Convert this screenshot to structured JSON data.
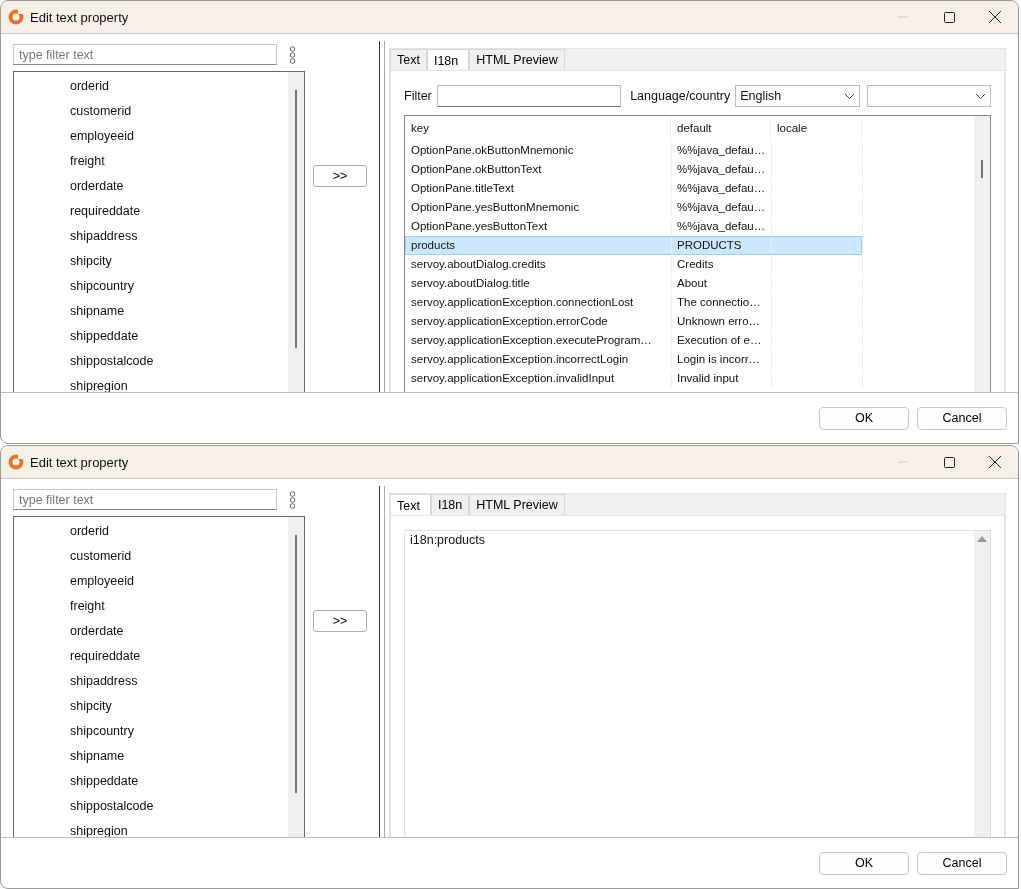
{
  "dialogs": [
    {
      "title": "Edit text property",
      "filter": {
        "placeholder": "type filter text"
      },
      "fields": [
        "orderid",
        "customerid",
        "employeeid",
        "freight",
        "orderdate",
        "requireddate",
        "shipaddress",
        "shipcity",
        "shipcountry",
        "shipname",
        "shippeddate",
        "shippostalcode",
        "shipregion"
      ],
      "move_button": ">>",
      "tabs": [
        {
          "label": "Text",
          "selected": false
        },
        {
          "label": "I18n",
          "selected": true
        },
        {
          "label": "HTML Preview",
          "selected": false
        }
      ],
      "panel": {
        "kind": "i18n",
        "filter_label": "Filter",
        "language_label": "Language/country",
        "language": "English",
        "table": {
          "columns": [
            "key",
            "default",
            "locale"
          ],
          "rows": [
            {
              "key": "OptionPane.okButtonMnemonic",
              "default": "%%java_defau…",
              "selected": false
            },
            {
              "key": "OptionPane.okButtonText",
              "default": "%%java_defau…",
              "selected": false
            },
            {
              "key": "OptionPane.titleText",
              "default": "%%java_defau…",
              "selected": false
            },
            {
              "key": "OptionPane.yesButtonMnemonic",
              "default": "%%java_defau…",
              "selected": false
            },
            {
              "key": "OptionPane.yesButtonText",
              "default": "%%java_defau…",
              "selected": false
            },
            {
              "key": "products",
              "default": "PRODUCTS",
              "selected": true
            },
            {
              "key": "servoy.aboutDialog.credits",
              "default": "Credits",
              "selected": false
            },
            {
              "key": "servoy.aboutDialog.title",
              "default": "About",
              "selected": false
            },
            {
              "key": "servoy.applicationException.connectionLost",
              "default": "The connectio…",
              "selected": false
            },
            {
              "key": "servoy.applicationException.errorCode",
              "default": "Unknown erro…",
              "selected": false
            },
            {
              "key": "servoy.applicationException.executeProgram…",
              "default": "Execution of e…",
              "selected": false
            },
            {
              "key": "servoy.applicationException.incorrectLogin",
              "default": "Login is incorr…",
              "selected": false
            },
            {
              "key": "servoy.applicationException.invalidInput",
              "default": "Invalid input",
              "selected": false
            }
          ]
        }
      },
      "buttons": [
        "OK",
        "Cancel"
      ]
    },
    {
      "title": "Edit text property",
      "filter": {
        "placeholder": "type filter text"
      },
      "fields": [
        "orderid",
        "customerid",
        "employeeid",
        "freight",
        "orderdate",
        "requireddate",
        "shipaddress",
        "shipcity",
        "shipcountry",
        "shipname",
        "shippeddate",
        "shippostalcode",
        "shipregion"
      ],
      "move_button": ">>",
      "tabs": [
        {
          "label": "Text",
          "selected": true
        },
        {
          "label": "I18n",
          "selected": false
        },
        {
          "label": "HTML Preview",
          "selected": false
        }
      ],
      "panel": {
        "kind": "text",
        "value": "i18n:products"
      },
      "buttons": [
        "OK",
        "Cancel"
      ]
    }
  ]
}
